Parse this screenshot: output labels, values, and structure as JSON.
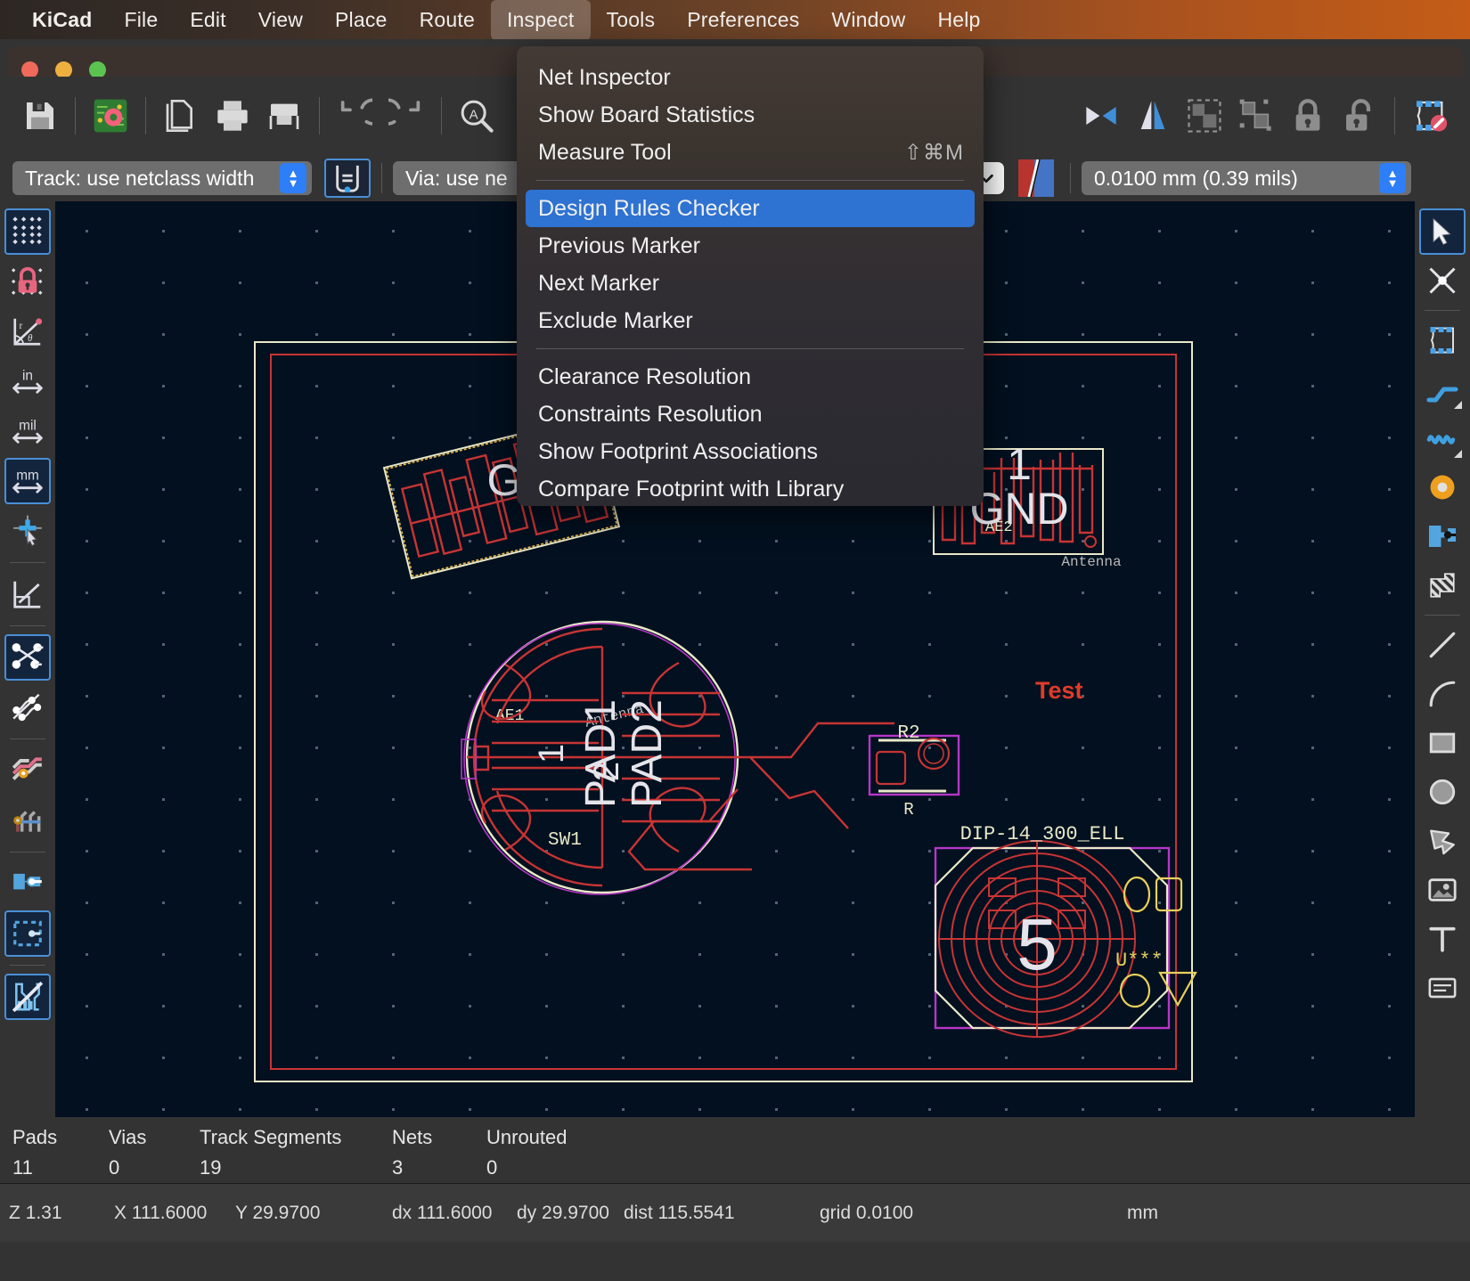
{
  "menubar": {
    "items": [
      {
        "label": "KiCad",
        "bold": true,
        "active": false
      },
      {
        "label": "File",
        "bold": false,
        "active": false
      },
      {
        "label": "Edit",
        "bold": false,
        "active": false
      },
      {
        "label": "View",
        "bold": false,
        "active": false
      },
      {
        "label": "Place",
        "bold": false,
        "active": false
      },
      {
        "label": "Route",
        "bold": false,
        "active": false
      },
      {
        "label": "Inspect",
        "bold": false,
        "active": true
      },
      {
        "label": "Tools",
        "bold": false,
        "active": false
      },
      {
        "label": "Preferences",
        "bold": false,
        "active": false
      },
      {
        "label": "Window",
        "bold": false,
        "active": false
      },
      {
        "label": "Help",
        "bold": false,
        "active": false
      }
    ]
  },
  "window_controls": {
    "close": "close-button",
    "minimize": "minimize-button",
    "maximize": "maximize-button"
  },
  "dropdown": {
    "title": "Inspect",
    "items": [
      {
        "label": "Net Inspector",
        "accel": "",
        "highlighted": false
      },
      {
        "label": "Show Board Statistics",
        "accel": "",
        "highlighted": false
      },
      {
        "label": "Measure Tool",
        "accel": "⇧⌘M",
        "highlighted": false
      },
      {
        "separator": true
      },
      {
        "label": "Design Rules Checker",
        "accel": "",
        "highlighted": true
      },
      {
        "label": "Previous Marker",
        "accel": "",
        "highlighted": false
      },
      {
        "label": "Next Marker",
        "accel": "",
        "highlighted": false
      },
      {
        "label": "Exclude Marker",
        "accel": "",
        "highlighted": false
      },
      {
        "separator": true
      },
      {
        "label": "Clearance Resolution",
        "accel": "",
        "highlighted": false
      },
      {
        "label": "Constraints Resolution",
        "accel": "",
        "highlighted": false
      },
      {
        "label": "Show Footprint Associations",
        "accel": "",
        "highlighted": false
      },
      {
        "label": "Compare Footprint with Library",
        "accel": "",
        "highlighted": false
      }
    ]
  },
  "toolbar": {
    "buttons": [
      {
        "name": "save-icon"
      },
      {
        "sep": true
      },
      {
        "name": "board-setup-icon"
      },
      {
        "sep": true
      },
      {
        "name": "page-settings-icon"
      },
      {
        "name": "print-icon"
      },
      {
        "name": "plot-icon"
      },
      {
        "sep": true
      },
      {
        "name": "undo-icon"
      },
      {
        "name": "redo-icon"
      },
      {
        "sep": true
      },
      {
        "name": "find-icon"
      }
    ],
    "right_buttons": [
      {
        "name": "mirror-horizontal-icon"
      },
      {
        "name": "mirror-vertical-icon"
      },
      {
        "name": "group-icon"
      },
      {
        "name": "ungroup-icon"
      },
      {
        "name": "lock-icon"
      },
      {
        "name": "unlock-icon"
      },
      {
        "sep": true
      },
      {
        "name": "footprint-editor-icon"
      }
    ]
  },
  "toolbar2": {
    "track_width": {
      "value": "Track: use netclass width",
      "name": "track-width-select"
    },
    "track_width_mode": {
      "name": "track-netclass-toggle-icon"
    },
    "via_size": {
      "value": "Via: use ne",
      "name": "via-size-select"
    },
    "layer_select": {
      "name": "layer-select-chevron"
    },
    "layer_pair": {
      "name": "layer-pair-swatch"
    },
    "grid_value": {
      "value": "0.0100 mm (0.39 mils)",
      "name": "grid-size-select"
    }
  },
  "left_toolbar": {
    "buttons": [
      {
        "name": "toggle-grid-icon",
        "selected": true
      },
      {
        "name": "grid-lock-icon",
        "selected": false
      },
      {
        "name": "polar-coords-icon",
        "selected": false
      },
      {
        "name": "units-inches-icon",
        "selected": false,
        "label": "in"
      },
      {
        "name": "units-mils-icon",
        "selected": false,
        "label": "mil"
      },
      {
        "name": "units-mm-icon",
        "selected": true,
        "label": "mm"
      },
      {
        "name": "full-crosshair-icon",
        "selected": false
      },
      {
        "sep": true
      },
      {
        "name": "show-ratsnest-lines-icon",
        "selected": false
      },
      {
        "sep": true
      },
      {
        "name": "show-ratsnest-icon",
        "selected": true
      },
      {
        "name": "curved-ratsnest-icon",
        "selected": false
      },
      {
        "sep": true
      },
      {
        "name": "track-fill-icon",
        "selected": false
      },
      {
        "name": "via-fill-icon",
        "selected": false
      },
      {
        "sep": true
      },
      {
        "name": "pad-fill-icon",
        "selected": false
      },
      {
        "name": "pad-sketch-icon",
        "selected": true
      },
      {
        "sep": true
      },
      {
        "name": "zone-display-icon",
        "selected": true
      }
    ]
  },
  "right_toolbar": {
    "buttons": [
      {
        "name": "select-tool-icon",
        "selected": true
      },
      {
        "name": "highlight-net-tool-icon",
        "selected": false
      },
      {
        "sep": true
      },
      {
        "name": "add-footprint-tool-icon",
        "selected": false
      },
      {
        "name": "route-track-tool-icon",
        "selected": false,
        "corner": true
      },
      {
        "name": "route-differential-pair-tool-icon",
        "selected": false,
        "corner": true
      },
      {
        "name": "add-via-tool-icon",
        "selected": false
      },
      {
        "name": "add-zone-tool-icon",
        "selected": false
      },
      {
        "name": "add-rule-area-tool-icon",
        "selected": false
      },
      {
        "sep": true
      },
      {
        "name": "draw-line-tool-icon",
        "selected": false
      },
      {
        "name": "draw-arc-tool-icon",
        "selected": false
      },
      {
        "name": "draw-rectangle-tool-icon",
        "selected": false
      },
      {
        "name": "draw-circle-tool-icon",
        "selected": false
      },
      {
        "name": "draw-polygon-tool-icon",
        "selected": false
      },
      {
        "name": "add-image-tool-icon",
        "selected": false
      },
      {
        "name": "add-text-tool-icon",
        "selected": false
      },
      {
        "name": "add-dimension-tool-icon",
        "selected": false
      }
    ]
  },
  "statusbar": {
    "columns": [
      {
        "header": "Pads",
        "value": "11"
      },
      {
        "header": "Vias",
        "value": "0"
      },
      {
        "header": "Track Segments",
        "value": "19"
      },
      {
        "header": "Nets",
        "value": "3"
      },
      {
        "header": "Unrouted",
        "value": "0"
      }
    ]
  },
  "statusbar2": {
    "zoom": "Z 1.31",
    "x": "X 111.6000",
    "y": "Y 29.9700",
    "dx": "dx 111.6000",
    "dy": "dy 29.9700",
    "dist": "dist 115.5541",
    "grid": "grid 0.0100",
    "units": "mm"
  },
  "canvas": {
    "labels": {
      "ae1_pad": "1",
      "ae1_gnd": "GND",
      "ae1_ref": "AE1",
      "ae1_value": "Antenna",
      "ae2_pad": "1",
      "ae2_gnd": "GND",
      "ae2_ref": "AE2",
      "ae2_value": "Antenna",
      "sw1_ref": "SW1",
      "sw1_pad1": "PAD1",
      "sw1_pad2": "PAD2",
      "sw1_num1": "1",
      "sw1_num2": "2",
      "r2_ref": "R2",
      "r2_value": "R",
      "test_text": "Test",
      "dip_ref": "DIP-14_300_ELL",
      "dip_pad5": "5",
      "dip_value": "U***"
    },
    "colors": {
      "background": "#02101f",
      "copper_top": "#c83434",
      "silkscreen": "#e9e9c8",
      "courtyard": "#cf2fcf",
      "board_outline": "#c83434",
      "text_white": "#e4e4ea",
      "test_red": "#e13b2a",
      "grid_dot": "#51637a"
    }
  }
}
